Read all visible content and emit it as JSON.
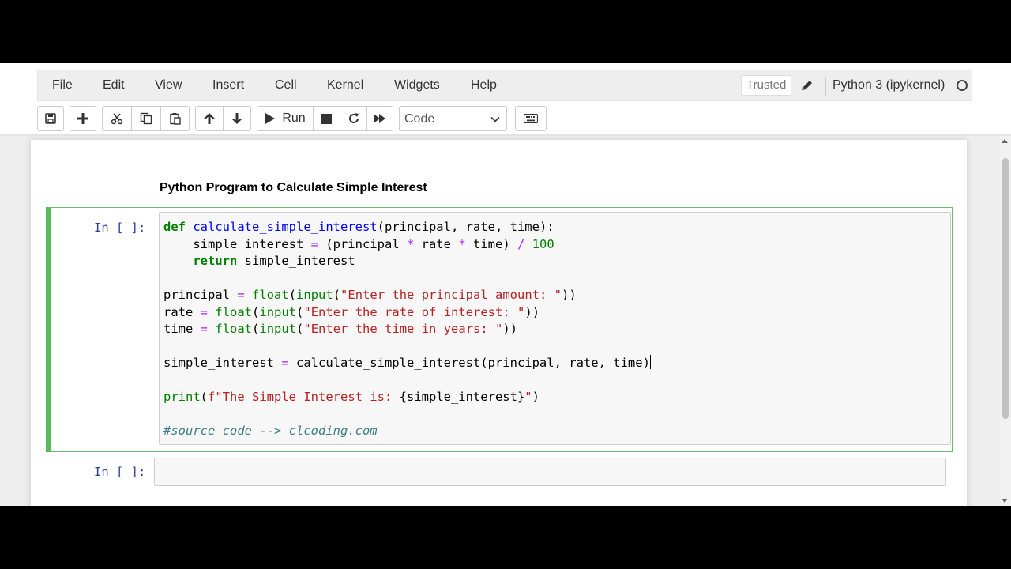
{
  "menu": {
    "items": [
      "File",
      "Edit",
      "View",
      "Insert",
      "Cell",
      "Kernel",
      "Widgets",
      "Help"
    ],
    "trusted": "Trusted",
    "kernel": "Python 3 (ipykernel)"
  },
  "toolbar": {
    "run_label": "Run",
    "cell_type": "Code",
    "icons": [
      "save-icon",
      "plus-icon",
      "cut-icon",
      "copy-icon",
      "paste-icon",
      "arrow-up-icon",
      "arrow-down-icon",
      "play-icon",
      "stop-icon",
      "restart-icon",
      "fast-forward-icon",
      "keyboard-icon"
    ]
  },
  "notebook": {
    "markdown_title": "Python Program to Calculate Simple Interest",
    "code_cell": {
      "prompt": "In [ ]:",
      "lines": [
        "def calculate_simple_interest(principal, rate, time):",
        "    simple_interest = (principal * rate * time) / 100",
        "    return simple_interest",
        "",
        "principal = float(input(\"Enter the principal amount: \"))",
        "rate = float(input(\"Enter the rate of interest: \"))",
        "time = float(input(\"Enter the time in years: \"))",
        "",
        "simple_interest = calculate_simple_interest(principal, rate, time)",
        "",
        "print(f\"The Simple Interest is: {simple_interest}\")",
        "",
        "#source code --> clcoding.com"
      ]
    },
    "empty_cell": {
      "prompt": "In [ ]:"
    }
  },
  "colors": {
    "keyword": "#008000",
    "function_name": "#0000ff",
    "operator": "#aa22ff",
    "string": "#ba2121",
    "comment": "#408080",
    "prompt": "#303f9f",
    "selected_cell_border": "#5cb85c"
  }
}
